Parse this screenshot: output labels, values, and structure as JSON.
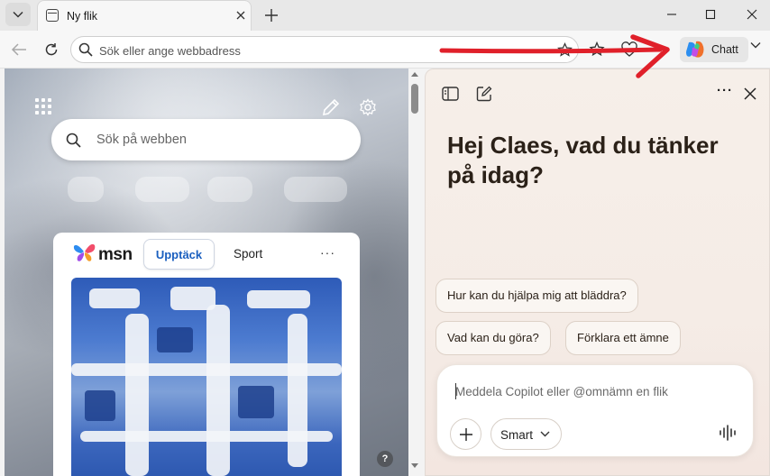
{
  "browser": {
    "tab": {
      "title": "Ny flik"
    },
    "address_bar": {
      "placeholder": "Sök eller ange webbadress"
    },
    "chat_button": {
      "label": "Chatt"
    }
  },
  "new_tab_page": {
    "search": {
      "placeholder": "Sök på webben"
    },
    "msn": {
      "brand": "msn",
      "tabs": [
        {
          "label": "Upptäck",
          "active": true
        },
        {
          "label": "Sport",
          "active": false
        }
      ],
      "more": "···"
    },
    "help": "?"
  },
  "copilot": {
    "heading": "Hej Claes, vad du tänker på idag?",
    "suggestions": [
      {
        "label": "Hur kan du hjälpa mig att bläddra?"
      },
      {
        "label": "Vad kan du göra?"
      },
      {
        "label": "Förklara ett ämne"
      }
    ],
    "composer": {
      "placeholder": "Meddela Copilot eller @omnämn en flik",
      "mode": "Smart"
    },
    "more": "···"
  },
  "colors": {
    "accent_blue": "#1a5fbf",
    "annotation_red": "#e0202a",
    "copilot_bg": "#f6efe9"
  }
}
